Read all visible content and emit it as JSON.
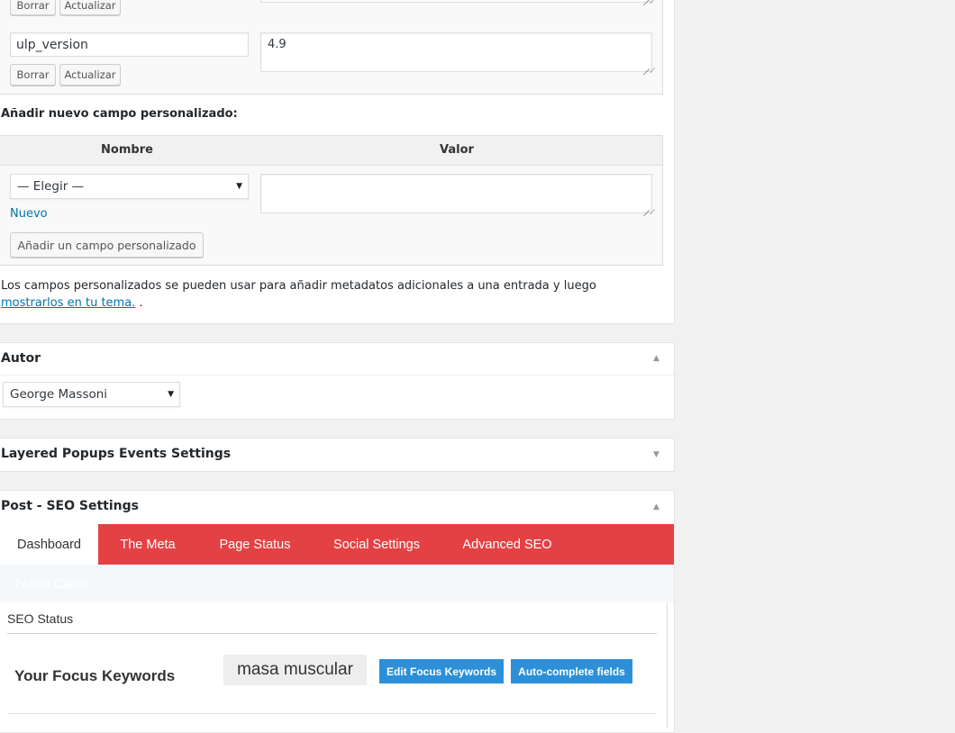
{
  "custom_fields": {
    "rows": [
      {
        "delete_label": "Borrar",
        "update_label": "Actualizar"
      },
      {
        "key": "ulp_version",
        "value": "4.9",
        "delete_label": "Borrar",
        "update_label": "Actualizar"
      }
    ],
    "add_new_title": "Añadir nuevo campo personalizado:",
    "col_name": "Nombre",
    "col_value": "Valor",
    "select_value": "— Elegir —",
    "new_link": "Nuevo",
    "add_button": "Añadir un campo personalizado",
    "help_text": "Los campos personalizados se pueden usar para añadir metadatos adicionales a una entrada y luego ",
    "help_link": "mostrarlos en tu tema.",
    "help_tail": " ."
  },
  "author_box": {
    "title": "Autor",
    "toggle_icon": "▲",
    "selected": "George Massoni"
  },
  "layered_box": {
    "title": "Layered Popups Events Settings",
    "toggle_icon": "▼"
  },
  "seo_box": {
    "title": "Post - SEO Settings",
    "toggle_icon": "▲",
    "tabs": [
      "Dashboard",
      "The Meta",
      "Page Status",
      "Social Settings",
      "Advanced SEO"
    ],
    "second_row_tab": "Twitter Cards",
    "status_label": "SEO Status",
    "focus_title": "Your Focus Keywords",
    "keyword": "masa muscular",
    "edit_button": "Edit Focus Keywords",
    "autocomplete_button": "Auto-complete fields"
  },
  "colors": {
    "tab_bar": "#e44145",
    "primary_button": "#2d8fd8",
    "link": "#0073aa"
  }
}
